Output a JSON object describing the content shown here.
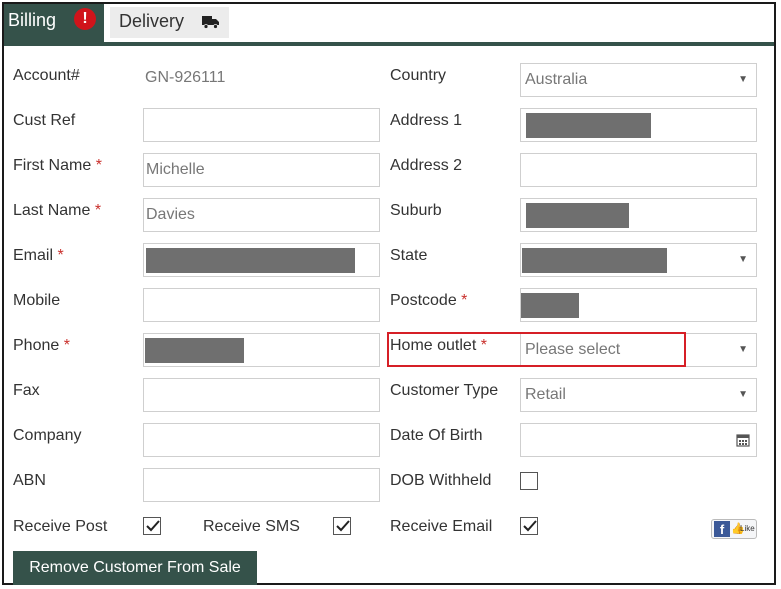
{
  "tabs": {
    "billing": "Billing",
    "billing_alert": "!",
    "delivery": "Delivery"
  },
  "required_mark": "*",
  "left": {
    "account_label": "Account#",
    "account_value": "GN-926111",
    "cust_ref_label": "Cust Ref",
    "cust_ref_value": "",
    "first_name_label": "First Name",
    "first_name_value": "Michelle",
    "last_name_label": "Last Name",
    "last_name_value": "Davies",
    "email_label": "Email",
    "mobile_label": "Mobile",
    "mobile_value": "",
    "phone_label": "Phone",
    "fax_label": "Fax",
    "fax_value": "",
    "company_label": "Company",
    "company_value": "",
    "abn_label": "ABN",
    "abn_value": ""
  },
  "right": {
    "country_label": "Country",
    "country_value": "Australia",
    "address1_label": "Address 1",
    "address2_label": "Address 2",
    "address2_value": "",
    "suburb_label": "Suburb",
    "state_label": "State",
    "postcode_label": "Postcode",
    "home_outlet_label": "Home outlet",
    "home_outlet_value": "Please select",
    "customer_type_label": "Customer Type",
    "customer_type_value": "Retail",
    "dob_label": "Date Of Birth",
    "dob_value": "",
    "dob_withheld_label": "DOB Withheld"
  },
  "checks": {
    "receive_post_label": "Receive Post",
    "receive_post": true,
    "receive_sms_label": "Receive SMS",
    "receive_sms": true,
    "receive_email_label": "Receive Email",
    "receive_email": true,
    "dob_withheld": false
  },
  "actions": {
    "remove_customer": "Remove Customer From Sale",
    "fb_like": "Like",
    "fb_logo": "f"
  },
  "colors": {
    "tab_active": "#35524a",
    "alert": "#d0141b",
    "highlight": "#d61f26",
    "redaction": "#6f6f6f"
  }
}
